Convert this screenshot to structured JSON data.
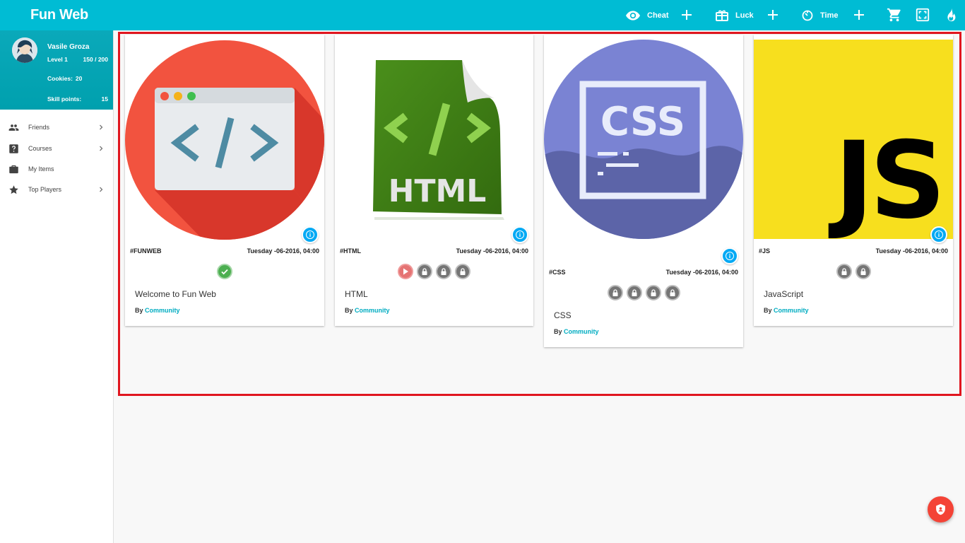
{
  "app": {
    "title": "Fun Web"
  },
  "topbar": {
    "cheat_label": "Cheat",
    "luck_label": "Luck",
    "time_label": "Time",
    "icons": [
      "eye-icon",
      "gift-icon",
      "timer-icon",
      "cart-icon",
      "fullscreen-icon",
      "fire-icon"
    ]
  },
  "profile": {
    "name": "Vasile Groza",
    "level_label": "Level 1",
    "xp": "150 / 200",
    "cookies_label": "Cookies:",
    "cookies_value": "20",
    "skill_label": "Skill points:",
    "skill_value": "15"
  },
  "sidebar": {
    "items": [
      {
        "label": "Friends",
        "icon": "people-icon"
      },
      {
        "label": "Courses",
        "icon": "question-icon"
      },
      {
        "label": "My Items",
        "icon": "briefcase-icon"
      },
      {
        "label": "Top Players",
        "icon": "star-icon"
      }
    ]
  },
  "courses": [
    {
      "tag": "#FUNWEB",
      "date": "Tuesday -06-2016, 04:00",
      "title": "Welcome to Fun Web",
      "by_label": "By",
      "author": "Community",
      "levels": [
        "completed"
      ]
    },
    {
      "tag": "#HTML",
      "date": "Tuesday -06-2016, 04:00",
      "title": "HTML",
      "by_label": "By",
      "author": "Community",
      "levels": [
        "in-progress",
        "locked",
        "locked",
        "locked"
      ],
      "image_text": "HTML"
    },
    {
      "tag": "#CSS",
      "date": "Tuesday -06-2016, 04:00",
      "title": "CSS",
      "by_label": "By",
      "author": "Community",
      "levels": [
        "locked",
        "locked",
        "locked",
        "locked"
      ],
      "image_text": "CSS"
    },
    {
      "tag": "#JS",
      "date": "Tuesday -06-2016, 04:00",
      "title": "JavaScript",
      "by_label": "By",
      "author": "Community",
      "levels": [
        "locked",
        "locked"
      ],
      "image_text": "JS"
    }
  ],
  "colors": {
    "accent": "#00bcd4",
    "info": "#03a9f4",
    "link": "#00acc1",
    "highlight_border": "#e0161f",
    "fab": "#f44336"
  }
}
